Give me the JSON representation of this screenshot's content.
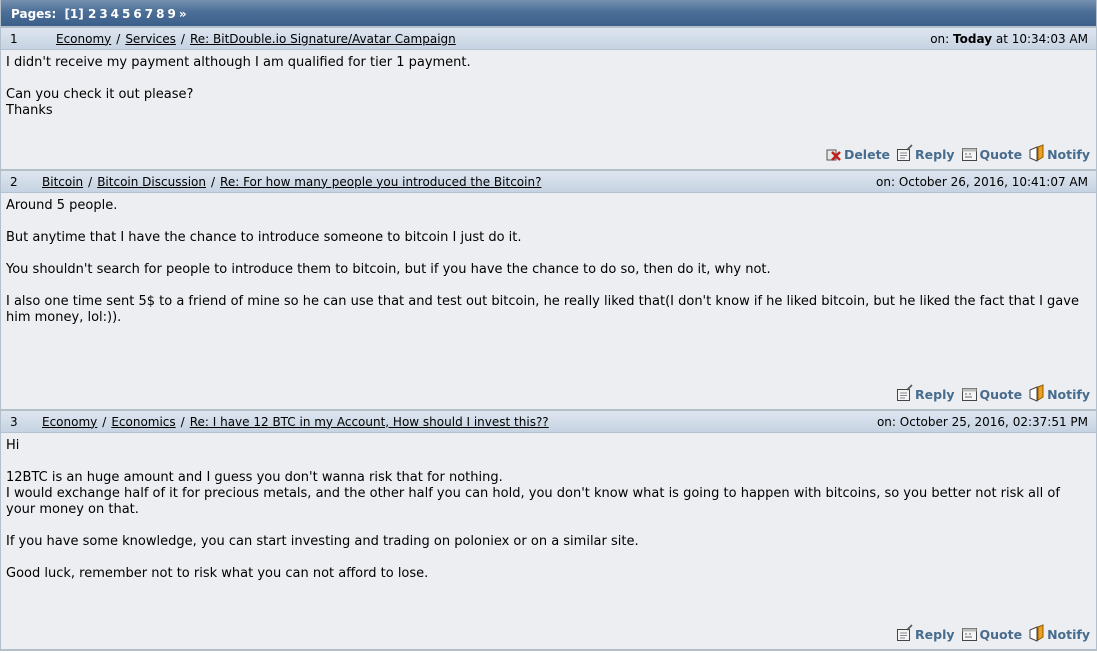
{
  "pagination": {
    "label": "Pages:",
    "current": "[1]",
    "pages": [
      "2",
      "3",
      "4",
      "5",
      "6",
      "7",
      "8",
      "9",
      "»"
    ]
  },
  "posts": [
    {
      "number": "1",
      "breadcrumb": [
        "Economy",
        "Services",
        "Re: BitDouble.io Signature/Avatar Campaign"
      ],
      "date_prefix": "on:",
      "date_bold": "Today",
      "date_rest": " at 10:34:03 AM",
      "body": [
        "I didn't receive my payment although I am qualified for tier 1 payment.",
        "",
        "Can you check it out please?",
        "Thanks"
      ],
      "actions": [
        "Delete",
        "Reply",
        "Quote",
        "Notify"
      ]
    },
    {
      "number": "2",
      "breadcrumb": [
        "Bitcoin",
        "Bitcoin Discussion",
        "Re: For how many people you introduced the Bitcoin?"
      ],
      "date_prefix": "on:",
      "date_rest": " October 26, 2016, 10:41:07 AM",
      "body": [
        "Around 5 people.",
        "",
        "But anytime that I have the chance to introduce someone to bitcoin I just do it.",
        "",
        "You shouldn't search for people to introduce them to bitcoin, but if you have the chance to do so, then do it, why not.",
        "",
        "I also one time sent 5$ to a friend of mine so he can use that and test out bitcoin, he really liked that(I don't know if he liked bitcoin, but he liked the fact that I gave him money, lol:))."
      ],
      "actions": [
        "Reply",
        "Quote",
        "Notify"
      ]
    },
    {
      "number": "3",
      "breadcrumb": [
        "Economy",
        "Economics",
        "Re: I have 12 BTC in my Account, How should I invest this??"
      ],
      "date_prefix": "on:",
      "date_rest": " October 25, 2016, 02:37:51 PM",
      "body": [
        "Hi",
        "",
        "12BTC is an huge amount and I guess you don't wanna risk that for nothing.",
        "I would exchange half of it for precious metals, and the other half you can hold, you don't know what is going to happen with bitcoins, so you better not risk all of your money on that.",
        "",
        "If you have some knowledge, you can start investing and trading on poloniex or on a similar site.",
        "",
        "Good luck, remember not to risk what you can not afford to lose."
      ],
      "actions": [
        "Reply",
        "Quote",
        "Notify"
      ]
    }
  ],
  "colors": {
    "header_gradient_top": "#7590b0",
    "header_gradient_bottom": "#3a5f8a",
    "action_link": "#476c8e",
    "post_bg": "#eceef1"
  }
}
